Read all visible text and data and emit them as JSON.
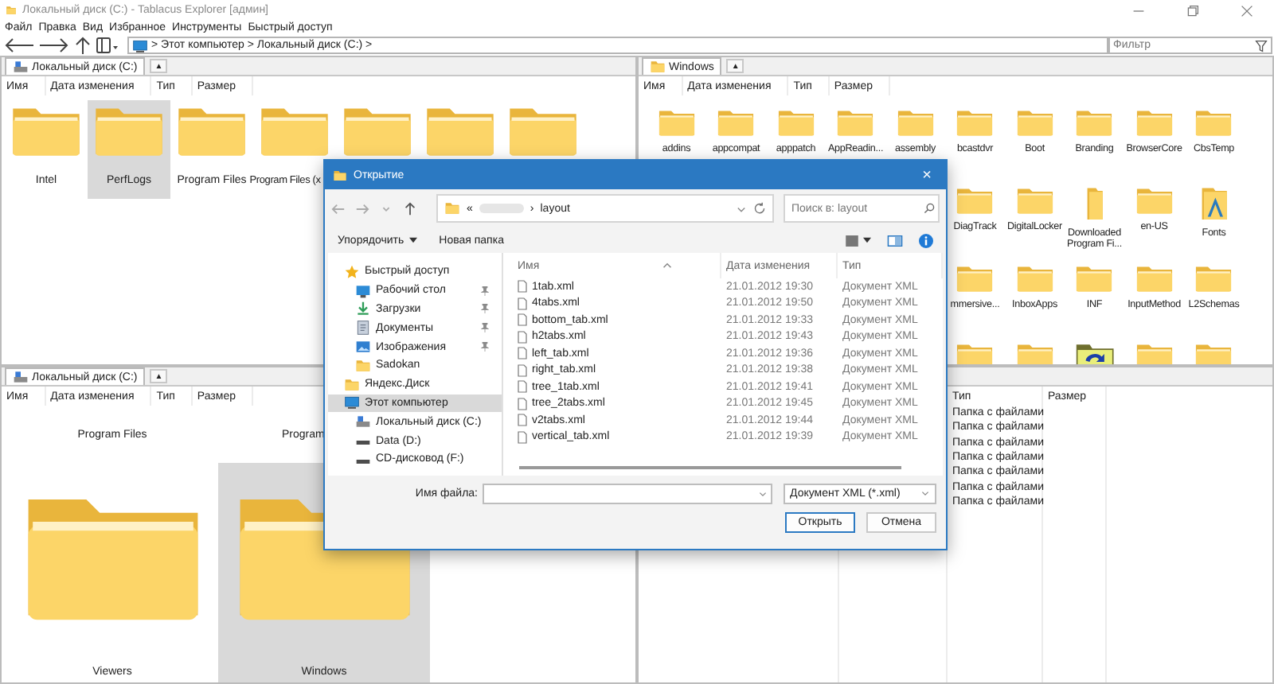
{
  "window": {
    "title": "Локальный диск (C:) - Tablacus Explorer [админ]"
  },
  "menu": [
    "Файл",
    "Правка",
    "Вид",
    "Избранное",
    "Инструменты",
    "Быстрый доступ"
  ],
  "address": {
    "path": "> Этот компьютер > Локальный диск (C:) >"
  },
  "filter": {
    "placeholder": "Фильтр"
  },
  "panes": [
    {
      "kind": "medium",
      "tab": {
        "label": "Локальный диск (C:)"
      },
      "add_button": "▲",
      "header_labels": [
        "Имя",
        "Дата изменения",
        "Тип",
        "Размер"
      ],
      "icon_rows": [
        [
          {
            "label": "Intel",
            "selected": false
          },
          {
            "label": "PerfLogs",
            "selected": true
          },
          {
            "label": "Program Files",
            "selected": false
          },
          {
            "label": "Program Files (x",
            "selected": false
          },
          {
            "selected": false
          },
          {
            "selected": false
          },
          {
            "selected": false
          }
        ]
      ]
    },
    {
      "kind": "small",
      "tab": {
        "label": "Windows"
      },
      "add_button": "▲",
      "header_labels": [
        "Имя",
        "Дата изменения",
        "Тип",
        "Размер"
      ],
      "icon_rows": [
        [
          {
            "label": "addins",
            "kind": "folder",
            "selected": false
          },
          {
            "label": "appcompat",
            "kind": "folder",
            "selected": false
          },
          {
            "label": "apppatch",
            "kind": "folder",
            "selected": false
          },
          {
            "label": "AppReadin...",
            "kind": "folder",
            "selected": false
          },
          {
            "label": "assembly",
            "kind": "folder",
            "selected": false
          },
          {
            "label": "bcastdvr",
            "kind": "folder",
            "selected": false
          },
          {
            "label": "Boot",
            "kind": "folder",
            "selected": false
          },
          {
            "label": "Branding",
            "kind": "folder",
            "selected": false
          },
          {
            "label": "BrowserCore",
            "kind": "folder",
            "selected": false
          },
          {
            "label": "CbsTemp",
            "kind": "folder",
            "selected": false
          }
        ],
        [
          {
            "label": "DiagTrack",
            "kind": "folder",
            "selected": false
          },
          {
            "label": "DigitalLocker",
            "kind": "folder",
            "selected": false
          },
          {
            "label": "Downloaded Program Fi...",
            "kind": "narrow",
            "selected": false
          },
          {
            "label": "en-US",
            "kind": "folder",
            "selected": false
          },
          {
            "label": "Fonts",
            "kind": "fonts",
            "selected": false
          }
        ],
        [
          {
            "label": "mmersive...",
            "kind": "folder",
            "selected": false
          },
          {
            "label": "InboxApps",
            "kind": "folder",
            "selected": false
          },
          {
            "label": "INF",
            "kind": "folder",
            "selected": false
          },
          {
            "label": "InputMethod",
            "kind": "folder",
            "selected": false
          },
          {
            "label": "L2Schemas",
            "kind": "folder",
            "selected": false
          }
        ],
        [
          {
            "kind": "folder",
            "selected": false
          },
          {
            "kind": "folder",
            "selected": false
          },
          {
            "kind": "sync",
            "selected": false
          },
          {
            "kind": "folder",
            "selected": false
          },
          {
            "kind": "folder",
            "selected": false
          }
        ]
      ]
    },
    {
      "kind": "large",
      "tab": {
        "label": "Локальный диск (C:)"
      },
      "add_button": "▲",
      "header_labels": [
        "Имя",
        "Дата изменения",
        "Тип",
        "Размер"
      ],
      "icon_rows": [
        [
          {
            "label": "Program Files"
          },
          {
            "label": "Program"
          }
        ],
        [
          {
            "label": "Viewers",
            "selected": false
          },
          {
            "label": "Windows",
            "selected": true
          }
        ]
      ]
    },
    {
      "kind": "details",
      "columns": [
        "Тип",
        "Размер"
      ],
      "rows": [
        {
          "type": "Папка с файлами"
        },
        {
          "type": "Папка с файлами"
        },
        {
          "type": "Папка с файлами"
        },
        {
          "type": "Папка с файлами"
        },
        {
          "type": "Папка с файлами"
        },
        {
          "type": "Папка с файлами"
        },
        {
          "type": "Папка с файлами"
        }
      ]
    }
  ],
  "dialog": {
    "title": "Открытие",
    "close": "×",
    "crumbs": [
      "«",
      "›",
      "layout"
    ],
    "search": {
      "placeholder": "Поиск в: layout"
    },
    "organize": "Упорядочить",
    "new_folder": "Новая папка",
    "nav": [
      {
        "label": "Быстрый доступ",
        "kind": "star",
        "selected": false,
        "children": [
          {
            "label": "Рабочий стол",
            "kind": "desktop",
            "pinned": true,
            "selected": false
          },
          {
            "label": "Загрузки",
            "kind": "download",
            "pinned": true,
            "selected": false
          },
          {
            "label": "Документы",
            "kind": "document",
            "pinned": true,
            "selected": false
          },
          {
            "label": "Изображения",
            "kind": "pictures",
            "pinned": true,
            "selected": false
          },
          {
            "label": "Sadokan",
            "kind": "folder",
            "pinned": false,
            "selected": false
          }
        ]
      },
      {
        "label": "Яндекс.Диск",
        "kind": "folder",
        "selected": false
      },
      {
        "label": "Этот компьютер",
        "kind": "pc",
        "selected": true,
        "children": [
          {
            "label": "Локальный диск (C:)",
            "kind": "drive",
            "pinned": false,
            "selected": false
          },
          {
            "label": "Data (D:)",
            "kind": "disk",
            "pinned": false,
            "selected": false
          },
          {
            "label": "CD-дисковод (F:)",
            "kind": "disk",
            "pinned": false,
            "selected": false
          }
        ]
      }
    ],
    "columns": [
      "Имя",
      "Дата изменения",
      "Тип"
    ],
    "files": [
      {
        "name": "1tab.xml",
        "date": "21.01.2012 19:30",
        "type": "Документ XML"
      },
      {
        "name": "4tabs.xml",
        "date": "21.01.2012 19:50",
        "type": "Документ XML"
      },
      {
        "name": "bottom_tab.xml",
        "date": "21.01.2012 19:33",
        "type": "Документ XML"
      },
      {
        "name": "h2tabs.xml",
        "date": "21.01.2012 19:43",
        "type": "Документ XML"
      },
      {
        "name": "left_tab.xml",
        "date": "21.01.2012 19:36",
        "type": "Документ XML"
      },
      {
        "name": "right_tab.xml",
        "date": "21.01.2012 19:38",
        "type": "Документ XML"
      },
      {
        "name": "tree_1tab.xml",
        "date": "21.01.2012 19:41",
        "type": "Документ XML"
      },
      {
        "name": "tree_2tabs.xml",
        "date": "21.01.2012 19:45",
        "type": "Документ XML"
      },
      {
        "name": "v2tabs.xml",
        "date": "21.01.2012 19:44",
        "type": "Документ XML"
      },
      {
        "name": "vertical_tab.xml",
        "date": "21.01.2012 19:39",
        "type": "Документ XML"
      }
    ],
    "filename": {
      "label": "Имя файла:"
    },
    "filetype": "Документ XML (*.xml)",
    "buttons": [
      {
        "label": "Открыть",
        "default": true
      },
      {
        "label": "Отмена",
        "default": false
      }
    ]
  }
}
